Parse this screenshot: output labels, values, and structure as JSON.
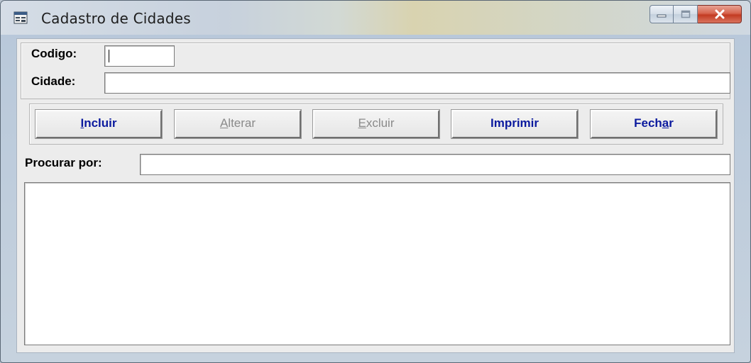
{
  "window": {
    "title": "Cadastro de Cidades"
  },
  "form": {
    "codigo_label": "Codigo:",
    "codigo_value": "",
    "cidade_label": "Cidade:",
    "cidade_value": ""
  },
  "toolbar": {
    "buttons": [
      {
        "pre": "",
        "key": "I",
        "post": "ncluir",
        "enabled": true
      },
      {
        "pre": "",
        "key": "A",
        "post": "lterar",
        "enabled": false
      },
      {
        "pre": "",
        "key": "E",
        "post": "xcluir",
        "enabled": false
      },
      {
        "pre": "Imprimir",
        "key": "",
        "post": "",
        "enabled": true
      },
      {
        "pre": "Fech",
        "key": "a",
        "post": "r",
        "enabled": true
      }
    ]
  },
  "search": {
    "label": "Procurar por:",
    "value": ""
  },
  "colors": {
    "button_text": "#0b1a9e",
    "button_disabled_text": "#8a8a8a",
    "close_button": "#c33b22"
  }
}
